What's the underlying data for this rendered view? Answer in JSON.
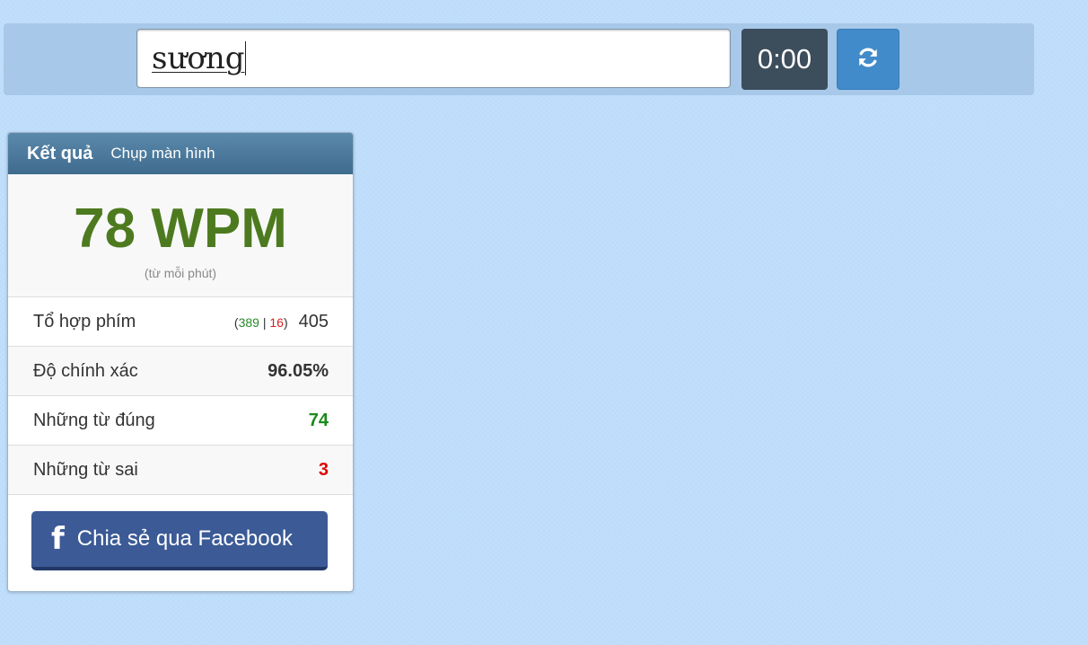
{
  "input_area": {
    "typed_text": "sương",
    "timer": "0:00"
  },
  "result": {
    "title": "Kết quả",
    "screenshot_link": "Chụp màn hình",
    "wpm": "78 WPM",
    "wpm_caption": "(từ mỗi phút)",
    "keystrokes": {
      "label": "Tổ hợp phím",
      "correct": "389",
      "wrong": "16",
      "total": "405"
    },
    "accuracy": {
      "label": "Độ chính xác",
      "value": "96.05%"
    },
    "correct_words": {
      "label": "Những từ đúng",
      "value": "74"
    },
    "wrong_words": {
      "label": "Những từ sai",
      "value": "3"
    },
    "share_button": "Chia sẻ qua Facebook"
  },
  "colors": {
    "background": "#bcdcfb",
    "wpm": "#4d7a1f",
    "correct": "#1a8a1a",
    "wrong": "#e00000",
    "facebook": "#3b5a96",
    "reset": "#428bca",
    "timer_bg": "#3c4d5c"
  },
  "icons": {
    "reset": "refresh-icon",
    "facebook": "facebook-icon"
  }
}
